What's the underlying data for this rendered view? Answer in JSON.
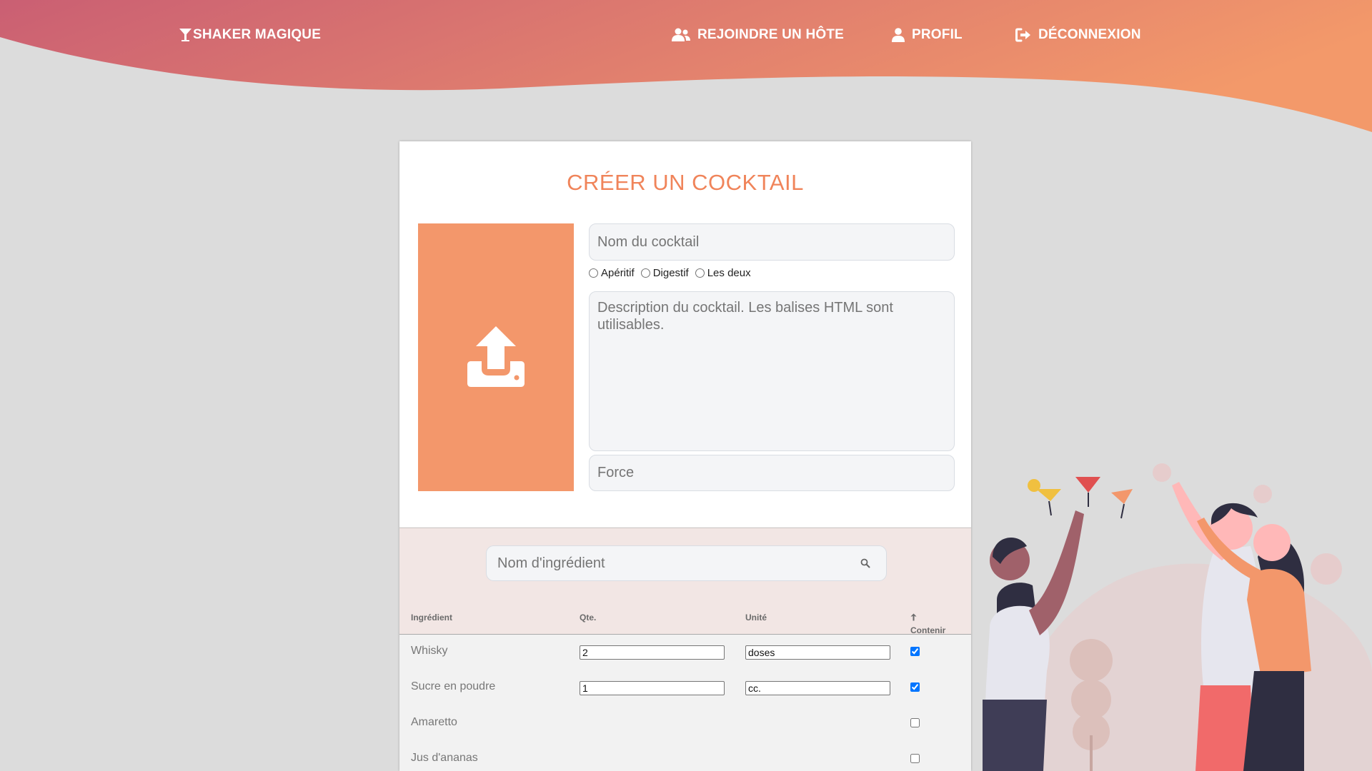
{
  "navbar": {
    "brand": "SHAKER MAGIQUE",
    "links": [
      {
        "label": "REJOINDRE UN HÔTE",
        "icon": "users-icon"
      },
      {
        "label": "PROFIL",
        "icon": "user-icon"
      },
      {
        "label": "DÉCONNEXION",
        "icon": "logout-icon"
      }
    ],
    "gradient_start": "#ca5f73",
    "gradient_end": "#f3996a"
  },
  "form": {
    "title": "CRÉER UN COCKTAIL",
    "upload_icon": "upload-icon",
    "name_placeholder": "Nom du cocktail",
    "types": [
      "Apéritif",
      "Digestif",
      "Les deux"
    ],
    "description_placeholder": "Description du cocktail. Les balises HTML sont utilisables.",
    "force_placeholder": "Force",
    "accent_color": "#f3976b"
  },
  "ingredient_search": {
    "placeholder": "Nom d'ingrédient",
    "icon": "search-icon"
  },
  "table": {
    "headers": [
      "Ingrédient",
      "Qte.",
      "Unité",
      "Contenir"
    ],
    "sort_icon": "arrow-up-icon",
    "rows": [
      {
        "name": "Whisky",
        "qty": "2",
        "unit": "doses",
        "contained": true
      },
      {
        "name": "Sucre en poudre",
        "qty": "1",
        "unit": "cc.",
        "contained": true
      },
      {
        "name": "Amaretto",
        "qty": "",
        "unit": "",
        "contained": false
      },
      {
        "name": "Jus d'ananas",
        "qty": "",
        "unit": "",
        "contained": false
      }
    ]
  }
}
